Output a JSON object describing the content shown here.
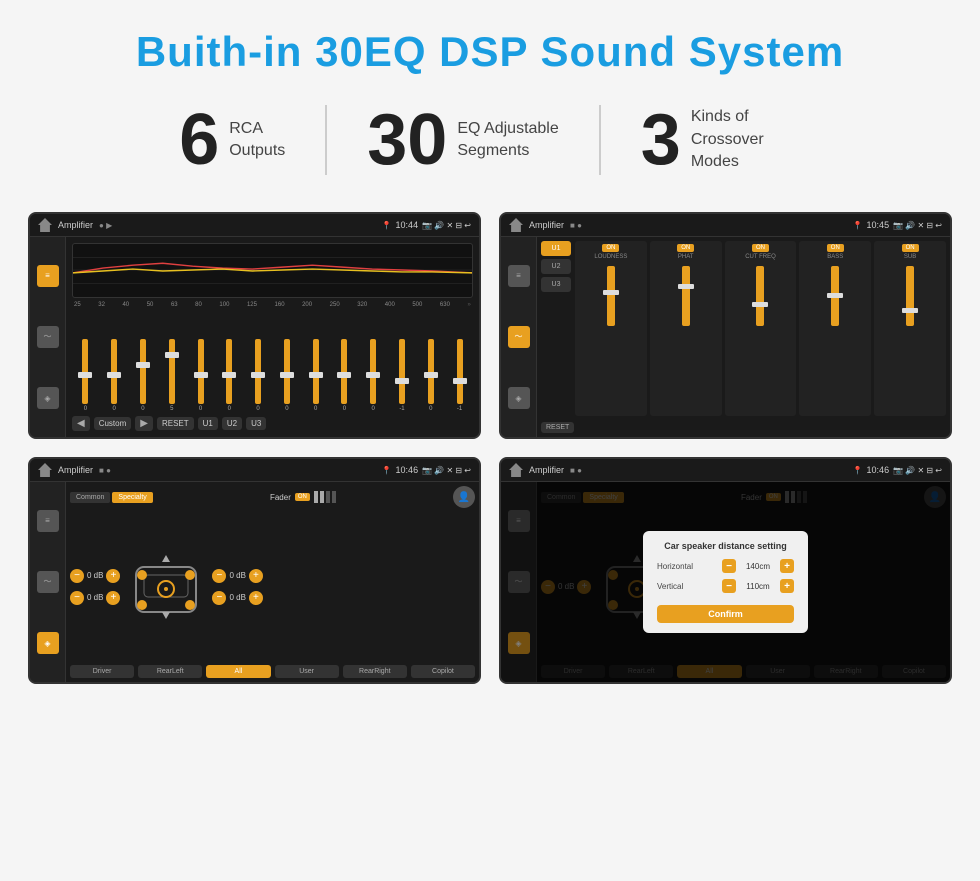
{
  "header": {
    "title": "Buith-in 30EQ DSP Sound System"
  },
  "stats": [
    {
      "number": "6",
      "label": "RCA\nOutputs"
    },
    {
      "number": "30",
      "label": "EQ Adjustable\nSegments"
    },
    {
      "number": "3",
      "label": "Kinds of\nCrossover Modes"
    }
  ],
  "screens": [
    {
      "id": "eq-screen",
      "status_left": "Amplifier",
      "time": "10:44",
      "eq_labels": [
        "25",
        "32",
        "40",
        "50",
        "63",
        "80",
        "100",
        "125",
        "160",
        "200",
        "250",
        "320",
        "400",
        "500",
        "630"
      ],
      "eq_values": [
        0,
        0,
        0,
        5,
        0,
        0,
        0,
        0,
        0,
        0,
        0,
        -1,
        0,
        -1
      ],
      "bottom_btns": [
        "Custom",
        "RESET",
        "U1",
        "U2",
        "U3"
      ]
    },
    {
      "id": "crossover-screen",
      "status_left": "Amplifier",
      "time": "10:45",
      "presets": [
        "U1",
        "U2",
        "U3"
      ],
      "channels": [
        {
          "name": "LOUDNESS",
          "on": true
        },
        {
          "name": "PHAT",
          "on": true
        },
        {
          "name": "CUT FREQ",
          "on": true
        },
        {
          "name": "BASS",
          "on": true
        },
        {
          "name": "SUB",
          "on": true
        }
      ],
      "reset_label": "RESET"
    },
    {
      "id": "fader-screen",
      "status_left": "Amplifier",
      "time": "10:46",
      "tabs": [
        "Common",
        "Specialty"
      ],
      "fader_label": "Fader",
      "on_label": "ON",
      "db_values": [
        "0 dB",
        "0 dB",
        "0 dB",
        "0 dB"
      ],
      "bottom_btns": [
        "Driver",
        "RearLeft",
        "All",
        "User",
        "RearRight",
        "Copilot"
      ]
    },
    {
      "id": "dialog-screen",
      "status_left": "Amplifier",
      "time": "10:46",
      "tabs": [
        "Common",
        "Specialty"
      ],
      "dialog": {
        "title": "Car speaker distance setting",
        "horizontal_label": "Horizontal",
        "horizontal_value": "140cm",
        "vertical_label": "Vertical",
        "vertical_value": "110cm",
        "confirm_label": "Confirm"
      },
      "db_values": [
        "0 dB",
        "0 dB"
      ],
      "bottom_btns": [
        "Driver",
        "RearLeft",
        "All",
        "User",
        "RearRight",
        "Copilot"
      ]
    }
  ]
}
